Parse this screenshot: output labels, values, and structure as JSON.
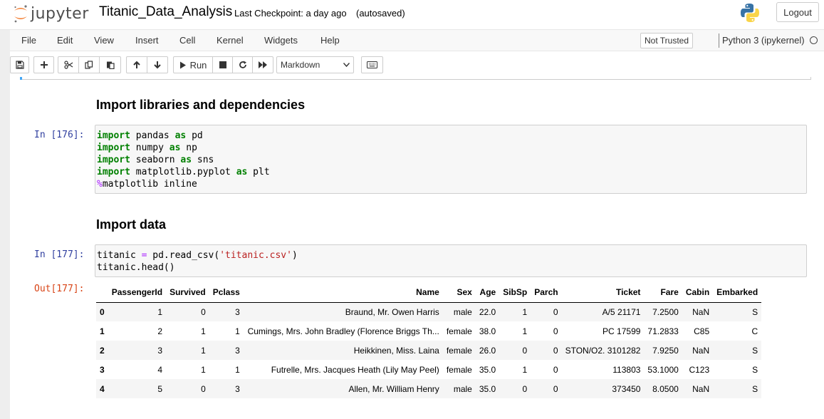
{
  "header": {
    "logo_text": "jupyter",
    "notebook_title": "Titanic_Data_Analysis",
    "checkpoint": "Last Checkpoint: a day ago",
    "autosave": "(autosaved)",
    "logout_label": "Logout"
  },
  "menubar": {
    "items": [
      "File",
      "Edit",
      "View",
      "Insert",
      "Cell",
      "Kernel",
      "Widgets",
      "Help"
    ],
    "trust_label": "Not Trusted",
    "kernel_name": "Python 3 (ipykernel)"
  },
  "toolbar": {
    "run_label": "Run",
    "cell_type": "Markdown",
    "icons": [
      "save-icon",
      "plus-icon",
      "cut-icon",
      "copy-icon",
      "paste-icon",
      "arrow-up-icon",
      "arrow-down-icon",
      "run-icon",
      "stop-icon",
      "restart-icon",
      "fast-forward-icon",
      "keyboard-icon"
    ]
  },
  "cells": {
    "heading1": "Import libraries and dependencies",
    "cell1": {
      "prompt": "In [176]:",
      "lines": [
        {
          "kw": "import",
          "a": " pandas ",
          "kw2": "as",
          "b": " pd"
        },
        {
          "kw": "import",
          "a": " numpy ",
          "kw2": "as",
          "b": " np"
        },
        {
          "kw": "import",
          "a": " seaborn ",
          "kw2": "as",
          "b": " sns"
        },
        {
          "kw": "import",
          "a": " matplotlib.pyplot ",
          "kw2": "as",
          "b": " plt"
        }
      ],
      "magic_symbol": "%",
      "magic_rest": "matplotlib inline"
    },
    "heading2": "Import data",
    "cell2": {
      "prompt": "In [177]:",
      "line1_a": "titanic ",
      "line1_op": "=",
      "line1_b": " pd.read_csv(",
      "line1_str": "'titanic.csv'",
      "line1_c": ")",
      "line2": "titanic.head()"
    },
    "out_prompt": "Out[177]:"
  },
  "dataframe": {
    "columns": [
      "",
      "PassengerId",
      "Survived",
      "Pclass",
      "Name",
      "Sex",
      "Age",
      "SibSp",
      "Parch",
      "Ticket",
      "Fare",
      "Cabin",
      "Embarked"
    ],
    "rows": [
      [
        "0",
        "1",
        "0",
        "3",
        "Braund, Mr. Owen Harris",
        "male",
        "22.0",
        "1",
        "0",
        "A/5 21171",
        "7.2500",
        "NaN",
        "S"
      ],
      [
        "1",
        "2",
        "1",
        "1",
        "Cumings, Mrs. John Bradley (Florence Briggs Th...",
        "female",
        "38.0",
        "1",
        "0",
        "PC 17599",
        "71.2833",
        "C85",
        "C"
      ],
      [
        "2",
        "3",
        "1",
        "3",
        "Heikkinen, Miss. Laina",
        "female",
        "26.0",
        "0",
        "0",
        "STON/O2. 3101282",
        "7.9250",
        "NaN",
        "S"
      ],
      [
        "3",
        "4",
        "1",
        "1",
        "Futrelle, Mrs. Jacques Heath (Lily May Peel)",
        "female",
        "35.0",
        "1",
        "0",
        "113803",
        "53.1000",
        "C123",
        "S"
      ],
      [
        "4",
        "5",
        "0",
        "3",
        "Allen, Mr. William Henry",
        "male",
        "35.0",
        "0",
        "0",
        "373450",
        "8.0500",
        "NaN",
        "S"
      ]
    ]
  },
  "colors": {
    "prompt_in": "#303f9f",
    "prompt_out": "#d84315",
    "keyword": "#008000",
    "magic": "#aa22ff",
    "string": "#ba2121",
    "logo_orange": "#f37726",
    "selected_cell_bar": "#42a5f5"
  }
}
